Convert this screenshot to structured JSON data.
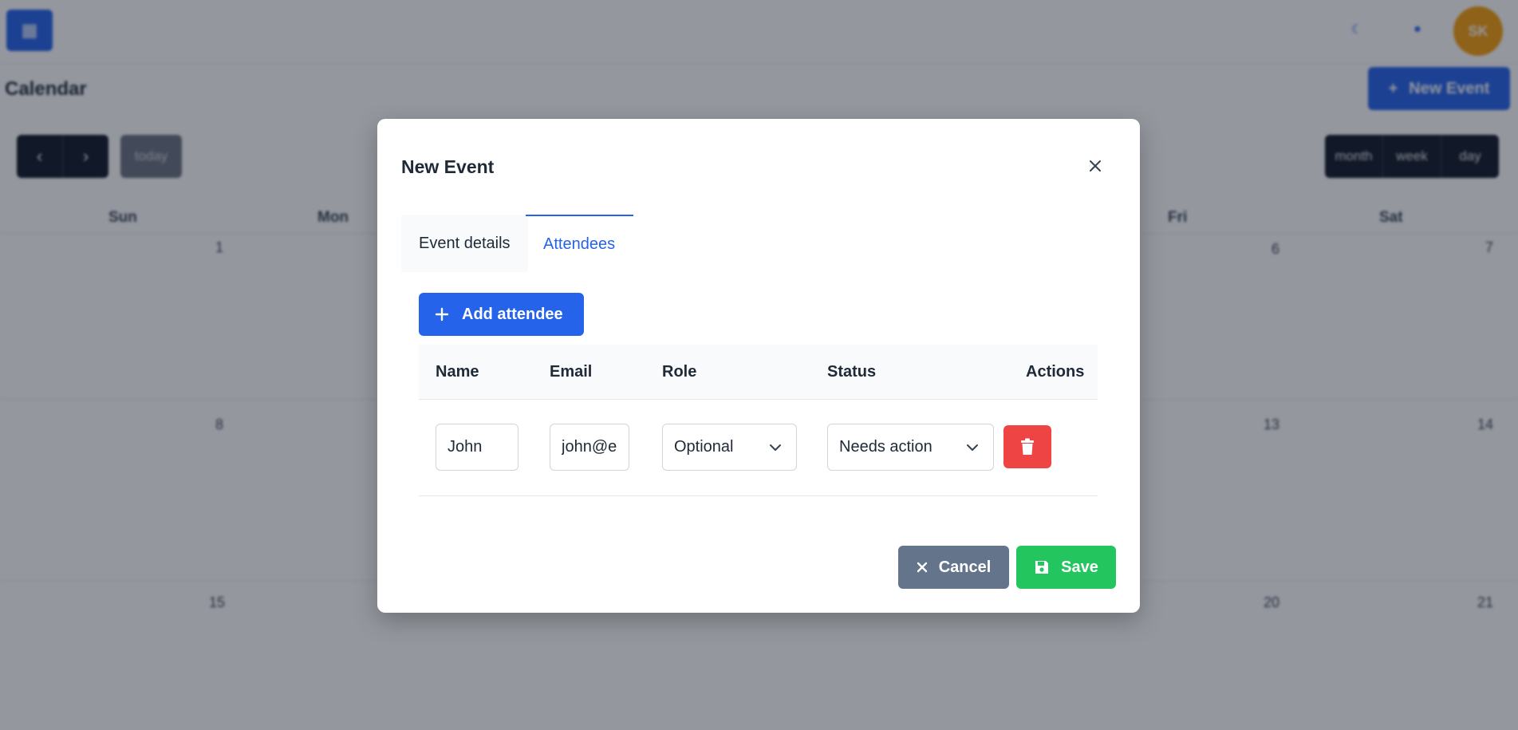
{
  "background": {
    "page_title": "Calendar",
    "new_event_label": "New Event",
    "today_label": "today",
    "views": [
      "month",
      "week",
      "day"
    ],
    "weekdays": [
      "Sun",
      "Mon",
      "Fri",
      "Sat"
    ],
    "day_numbers": [
      "1",
      "6",
      "7",
      "8",
      "13",
      "14",
      "15",
      "20",
      "21"
    ],
    "avatar_initials": "SK"
  },
  "modal": {
    "title": "New Event",
    "tabs": [
      {
        "label": "Event details",
        "active": false
      },
      {
        "label": "Attendees",
        "active": true
      }
    ],
    "add_attendee_label": "Add attendee",
    "columns": [
      "Name",
      "Email",
      "Role",
      "Status",
      "Actions"
    ],
    "attendees": [
      {
        "name": "John",
        "email": "john@e",
        "role": "Optional",
        "status": "Needs action"
      }
    ],
    "cancel_label": "Cancel",
    "save_label": "Save"
  },
  "colors": {
    "primary": "#2563eb",
    "danger": "#ef4444",
    "success": "#22c55e",
    "secondary": "#64748b",
    "avatar": "#f59e0b"
  },
  "icons": {
    "close": "close-icon",
    "add": "plus-icon",
    "chevron": "chevron-down-icon",
    "delete": "trash-icon",
    "cancel": "x-icon",
    "save": "floppy-disk-icon"
  }
}
